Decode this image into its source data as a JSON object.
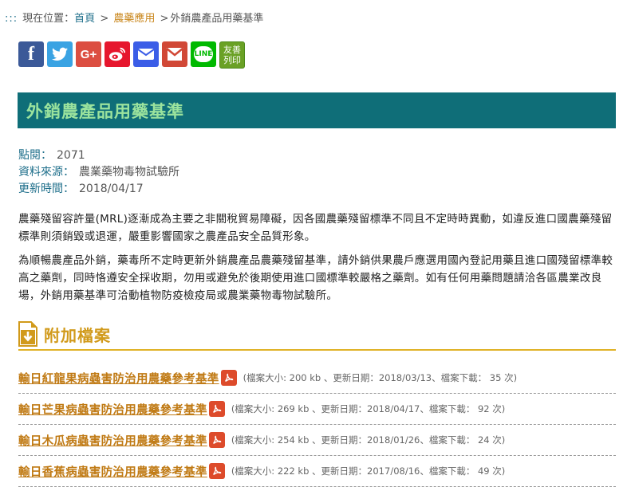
{
  "breadcrumb": {
    "anchor": ":::",
    "prefix": "現在位置：",
    "home": "首頁",
    "category": "農藥應用",
    "current": "外銷農產品用藥基準",
    "sep": ">"
  },
  "share": {
    "facebook": "f",
    "googleplus": "G+",
    "line": "LINE",
    "print_line1": "友善",
    "print_line2": "列印"
  },
  "article": {
    "title": "外銷農產品用藥基準",
    "views_label": "點閱：",
    "views": "2071",
    "source_label": "資料來源：",
    "source": "農業藥物毒物試驗所",
    "updated_label": "更新時間：",
    "updated": "2018/04/17",
    "para1": "農藥殘留容許量(MRL)逐漸成為主要之非關稅貿易障礙，因各國農藥殘留標準不同且不定時時異動，如違反進口國農藥殘留標準則須銷毀或退運，嚴重影響國家之農產品安全品質形象。",
    "para2": "為順暢農產品外銷，藥毒所不定時更新外銷農產品農藥殘留基準，請外銷供果農戶應選用國內登記用藥且進口國殘留標準較高之藥劑，同時恪遵安全採收期，勿用或避免於後期使用進口國標準較嚴格之藥劑。如有任何用藥問題請洽各區農業改良場，外銷用藥基準可洽動植物防疫檢疫局或農業藥物毒物試驗所。"
  },
  "attachments": {
    "heading": "附加檔案",
    "files": [
      {
        "name": "輸日紅龍果病蟲害防治用農藥參考基準",
        "info": "(檔案大小: 200 kb 、更新日期：2018/03/13、檔案下載： 35 次)"
      },
      {
        "name": "輸日芒果病蟲害防治用農藥參考基準",
        "info": "(檔案大小: 269 kb 、更新日期：2018/04/17、檔案下載： 92 次)"
      },
      {
        "name": "輸日木瓜病蟲害防治用農藥參考基準",
        "info": "(檔案大小: 254 kb 、更新日期：2018/01/26、檔案下載： 24 次)"
      },
      {
        "name": "輸日香蕉病蟲害防治用農藥參考基準",
        "info": "(檔案大小: 222 kb 、更新日期：2017/08/16、檔案下載： 49 次)"
      }
    ]
  },
  "colors": {
    "title_bg": "#0f6e78",
    "title_text": "#9be39d",
    "accent": "#d19a1b",
    "link": "#1f6f8b"
  }
}
